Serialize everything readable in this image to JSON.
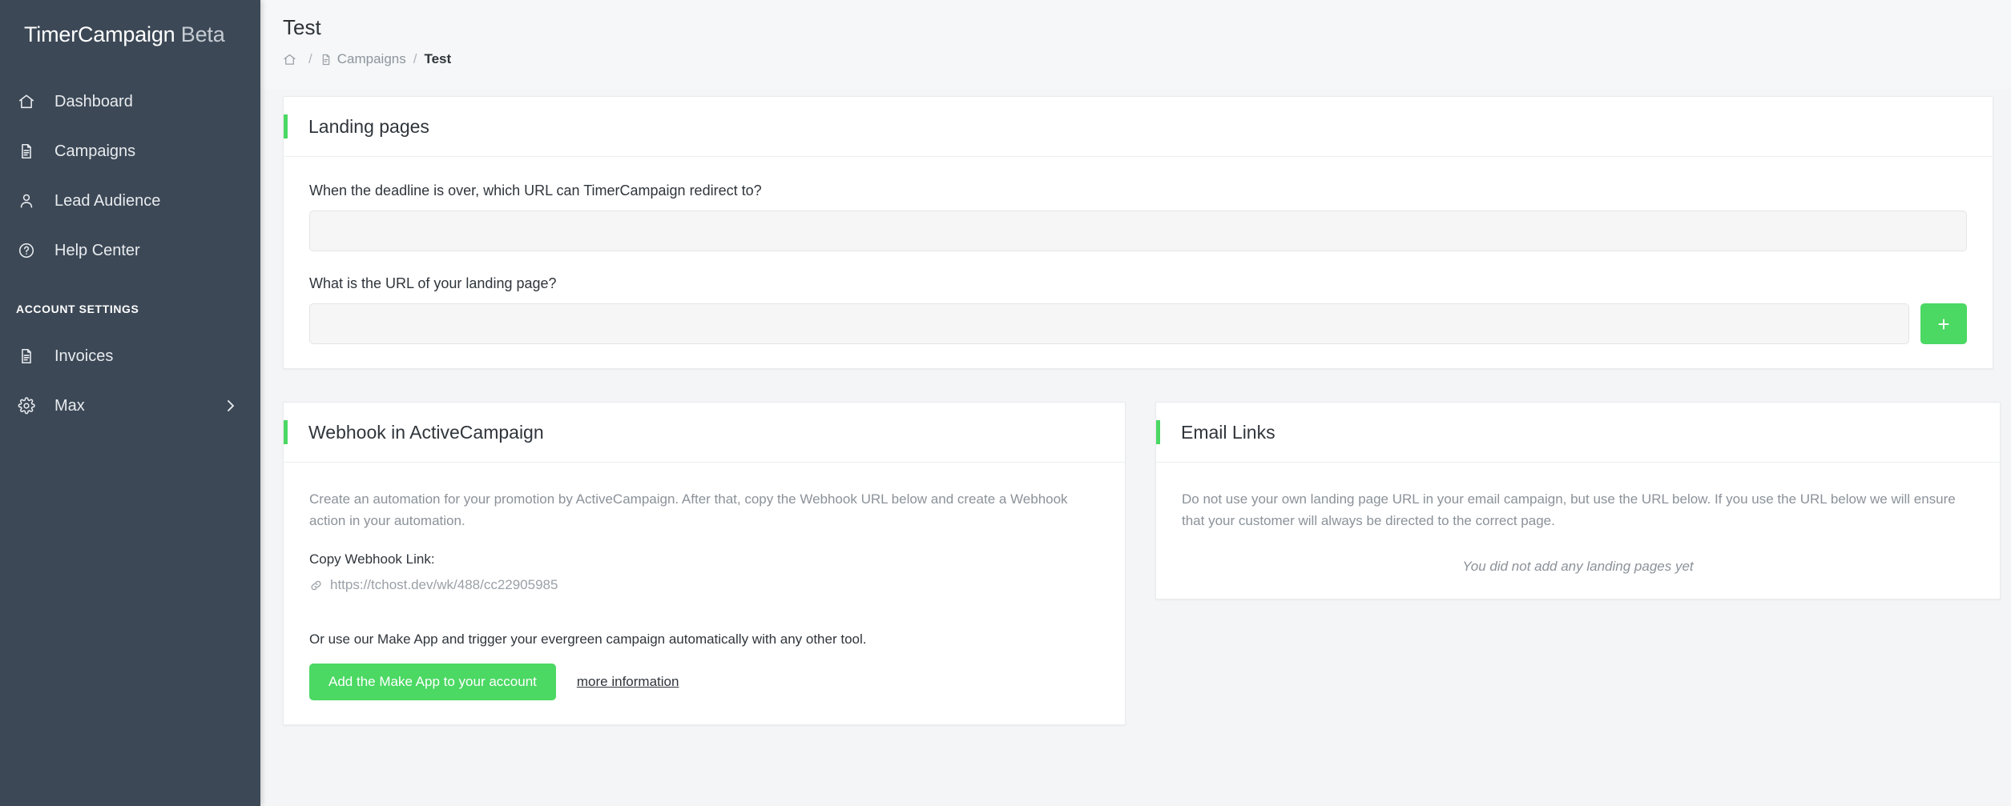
{
  "sidebar": {
    "brand_name": "TimerCampaign",
    "brand_suffix": "Beta",
    "items": [
      {
        "label": "Dashboard",
        "icon": "home-icon"
      },
      {
        "label": "Campaigns",
        "icon": "document-icon"
      },
      {
        "label": "Lead Audience",
        "icon": "user-icon"
      },
      {
        "label": "Help Center",
        "icon": "question-circle-icon"
      }
    ],
    "section_label": "ACCOUNT SETTINGS",
    "account_items": [
      {
        "label": "Invoices",
        "icon": "document-icon"
      },
      {
        "label": "Max",
        "icon": "gear-icon"
      }
    ]
  },
  "header": {
    "title": "Test",
    "breadcrumb": {
      "home_icon": "home-icon",
      "campaigns_icon": "document-icon",
      "campaigns": "Campaigns",
      "separator": "/",
      "current": "Test"
    }
  },
  "landing_pages": {
    "title": "Landing pages",
    "redirect_label": "When the deadline is over, which URL can TimerCampaign redirect to?",
    "redirect_value": "",
    "redirect_placeholder": "",
    "landing_label": "What is the URL of your landing page?",
    "landing_value": "",
    "landing_placeholder": "",
    "add_button_label": "+"
  },
  "webhook": {
    "title": "Webhook in ActiveCampaign",
    "description": "Create an automation for your promotion by ActiveCampaign. After that, copy the Webhook URL below and create a Webhook action in your automation.",
    "copy_label": "Copy Webhook Link:",
    "url": "https://tchost.dev/wk/488/cc22905985",
    "link_icon": "chain-link-icon",
    "make_text": "Or use our Make App and trigger your evergreen campaign automatically with any other tool.",
    "make_button_label": "Add the Make App to your account",
    "more_info_label": "more information"
  },
  "email_links": {
    "title": "Email Links",
    "description": "Do not use your own landing page URL in your email campaign, but use the URL below. If you use the URL below we will ensure that your customer will always be directed to the correct page.",
    "empty_state": "You did not add any landing pages yet"
  },
  "colors": {
    "sidebar_bg": "#3c4856",
    "accent_green": "#4bd863",
    "page_bg": "#f4f5f7",
    "card_bg": "#ffffff",
    "text_dark": "#2f353b",
    "text_muted": "#8b9299"
  }
}
